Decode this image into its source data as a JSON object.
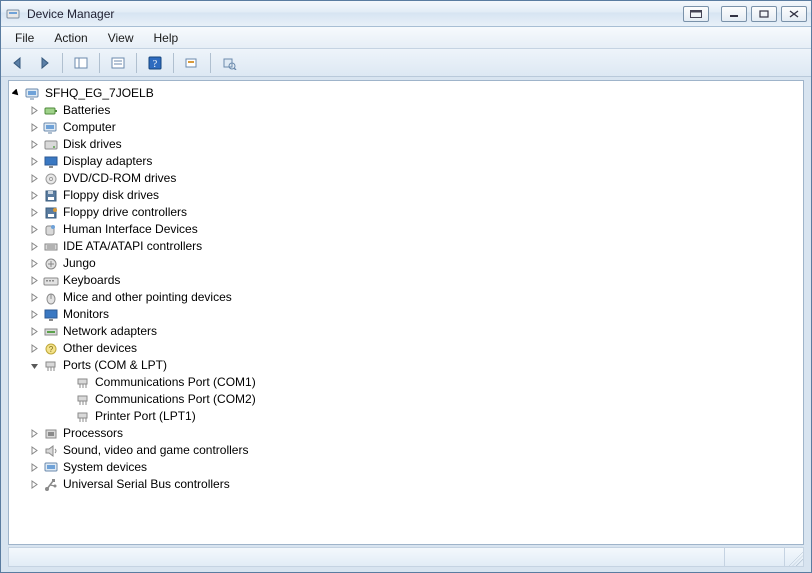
{
  "window": {
    "title": "Device Manager"
  },
  "menus": {
    "file": "File",
    "action": "Action",
    "view": "View",
    "help": "Help"
  },
  "root": {
    "name": "SFHQ_EG_7JOELB"
  },
  "categories": [
    {
      "label": "Batteries",
      "icon": "battery"
    },
    {
      "label": "Computer",
      "icon": "computer"
    },
    {
      "label": "Disk drives",
      "icon": "disk"
    },
    {
      "label": "Display adapters",
      "icon": "display"
    },
    {
      "label": "DVD/CD-ROM drives",
      "icon": "dvd"
    },
    {
      "label": "Floppy disk drives",
      "icon": "floppy"
    },
    {
      "label": "Floppy drive controllers",
      "icon": "floppyctrl"
    },
    {
      "label": "Human Interface Devices",
      "icon": "hid"
    },
    {
      "label": "IDE ATA/ATAPI controllers",
      "icon": "ide"
    },
    {
      "label": "Jungo",
      "icon": "jungo"
    },
    {
      "label": "Keyboards",
      "icon": "keyboard"
    },
    {
      "label": "Mice and other pointing devices",
      "icon": "mouse"
    },
    {
      "label": "Monitors",
      "icon": "monitor"
    },
    {
      "label": "Network adapters",
      "icon": "network"
    },
    {
      "label": "Other devices",
      "icon": "other"
    },
    {
      "label": "Ports (COM & LPT)",
      "icon": "port",
      "expanded": true
    },
    {
      "label": "Processors",
      "icon": "cpu"
    },
    {
      "label": "Sound, video and game controllers",
      "icon": "sound"
    },
    {
      "label": "System devices",
      "icon": "system"
    },
    {
      "label": "Universal Serial Bus controllers",
      "icon": "usb"
    }
  ],
  "ports_children": [
    {
      "label": "Communications Port (COM1)"
    },
    {
      "label": "Communications Port (COM2)"
    },
    {
      "label": "Printer Port (LPT1)"
    }
  ]
}
